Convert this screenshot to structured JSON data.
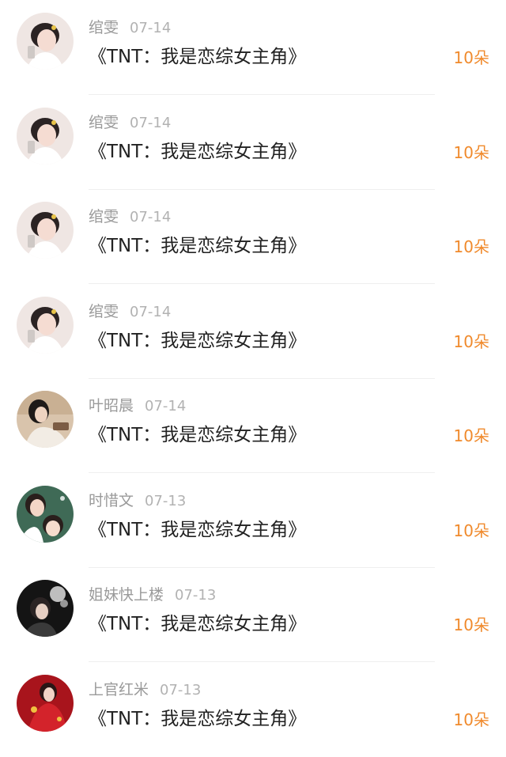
{
  "accent_color": "#f08a2c",
  "items": [
    {
      "user": "绾雯",
      "date": "07-14",
      "title": "《TNT：我是恋综女主角》",
      "count": "10朵",
      "avatar_icon": "girl-portrait-avatar-icon"
    },
    {
      "user": "绾雯",
      "date": "07-14",
      "title": "《TNT：我是恋综女主角》",
      "count": "10朵",
      "avatar_icon": "girl-portrait-avatar-icon"
    },
    {
      "user": "绾雯",
      "date": "07-14",
      "title": "《TNT：我是恋综女主角》",
      "count": "10朵",
      "avatar_icon": "girl-portrait-avatar-icon"
    },
    {
      "user": "绾雯",
      "date": "07-14",
      "title": "《TNT：我是恋综女主角》",
      "count": "10朵",
      "avatar_icon": "girl-portrait-avatar-icon"
    },
    {
      "user": "叶昭晨",
      "date": "07-14",
      "title": "《TNT：我是恋综女主角》",
      "count": "10朵",
      "avatar_icon": "woman-portrait-avatar-icon"
    },
    {
      "user": "时惜文",
      "date": "07-13",
      "title": "《TNT：我是恋综女主角》",
      "count": "10朵",
      "avatar_icon": "two-people-avatar-icon"
    },
    {
      "user": "姐妹快上楼",
      "date": "07-13",
      "title": "《TNT：我是恋综女主角》",
      "count": "10朵",
      "avatar_icon": "dark-portrait-avatar-icon"
    },
    {
      "user": "上官红米",
      "date": "07-13",
      "title": "《TNT：我是恋综女主角》",
      "count": "10朵",
      "avatar_icon": "red-dress-avatar-icon"
    }
  ]
}
